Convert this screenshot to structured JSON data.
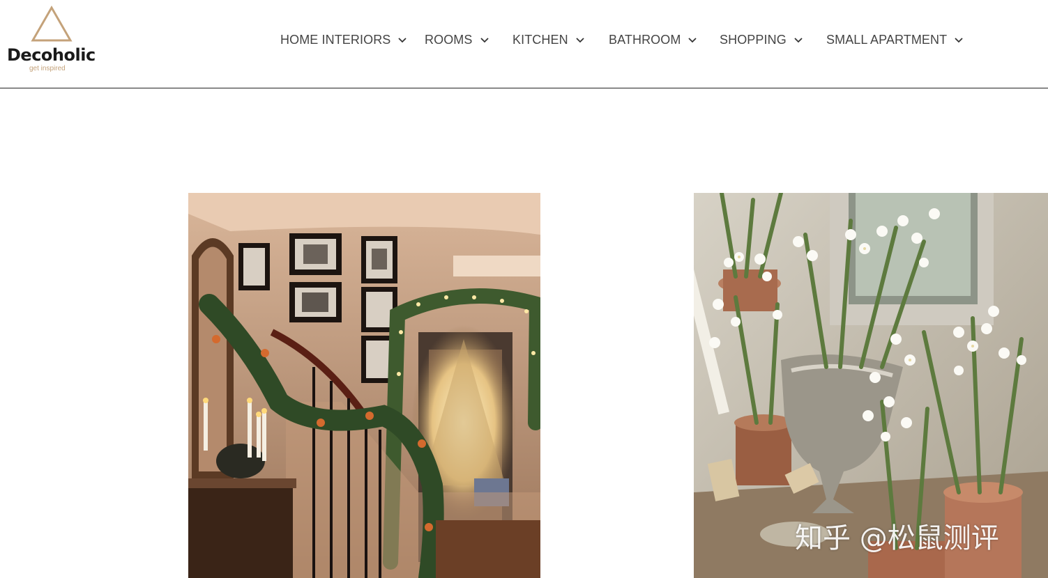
{
  "logo": {
    "name": "Decoholic",
    "tagline": "get inspired",
    "mark_color": "#c4a27a"
  },
  "nav": {
    "items": [
      {
        "label": "HOME INTERIORS",
        "icon": "chevron-down-icon"
      },
      {
        "label": "ROOMS",
        "icon": "chevron-down-icon"
      },
      {
        "label": "KITCHEN",
        "icon": "chevron-down-icon"
      },
      {
        "label": "BATHROOM",
        "icon": "chevron-down-icon"
      },
      {
        "label": "SHOPPING",
        "icon": "chevron-down-icon"
      },
      {
        "label": "SMALL APARTMENT",
        "icon": "chevron-down-icon"
      }
    ]
  },
  "gallery": {
    "images": [
      {
        "subject": "christmas-staircase-photo"
      },
      {
        "subject": "paperwhite-flowers-photo"
      }
    ]
  },
  "watermark": {
    "text": "知乎 @松鼠测评"
  }
}
